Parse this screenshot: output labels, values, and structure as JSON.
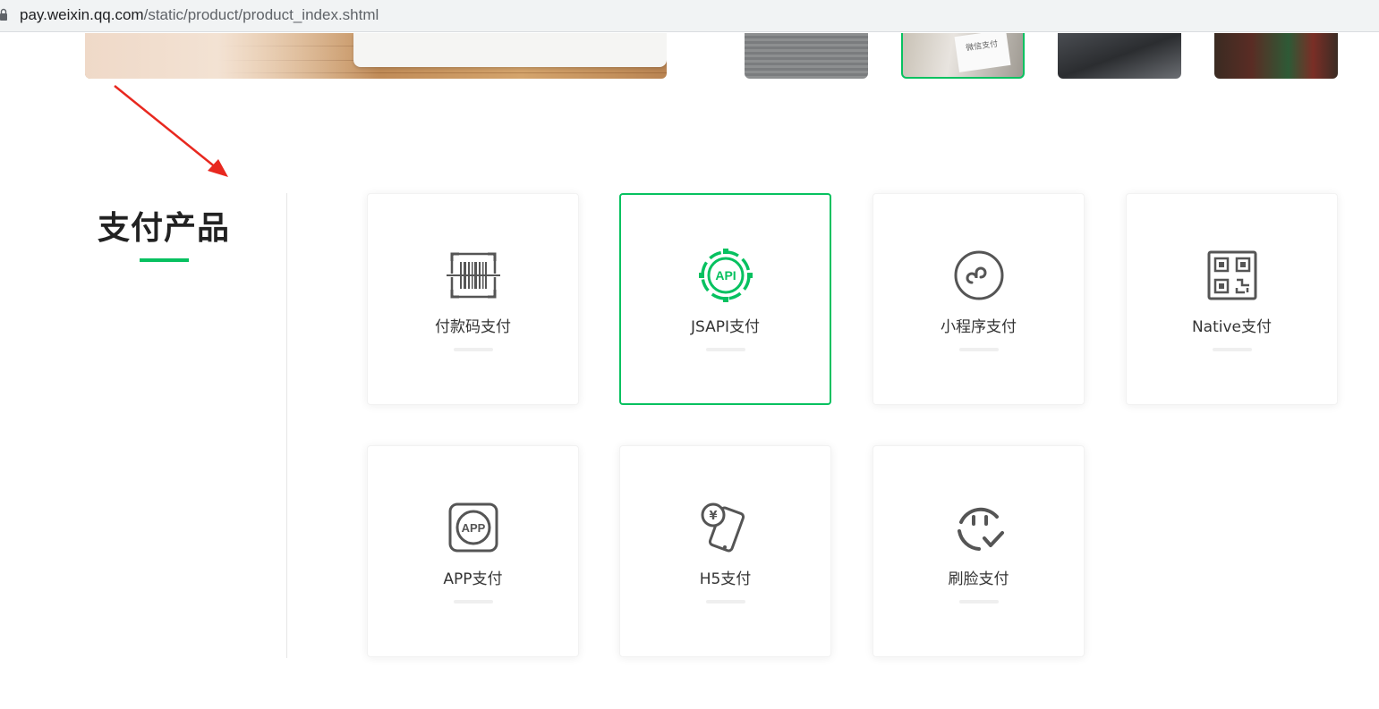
{
  "browser": {
    "url_domain": "pay.weixin.qq.com",
    "url_path": "/static/product/product_index.shtml"
  },
  "banner": {
    "thumb_tag": "微信支付"
  },
  "section": {
    "title": "支付产品"
  },
  "products": [
    {
      "label": "付款码支付",
      "icon": "barcode-icon"
    },
    {
      "label": "JSAPI支付",
      "icon": "api-icon"
    },
    {
      "label": "小程序支付",
      "icon": "mini-program-icon"
    },
    {
      "label": "Native支付",
      "icon": "qr-code-icon"
    },
    {
      "label": "APP支付",
      "icon": "app-icon"
    },
    {
      "label": "H5支付",
      "icon": "h5-phone-icon"
    },
    {
      "label": "刷脸支付",
      "icon": "face-pay-icon"
    }
  ],
  "icon_text": {
    "api": "API",
    "app": "APP",
    "yuan": "¥"
  },
  "colors": {
    "accent": "#07c160",
    "icon_gray": "#555555",
    "annotation": "#e8281f"
  }
}
